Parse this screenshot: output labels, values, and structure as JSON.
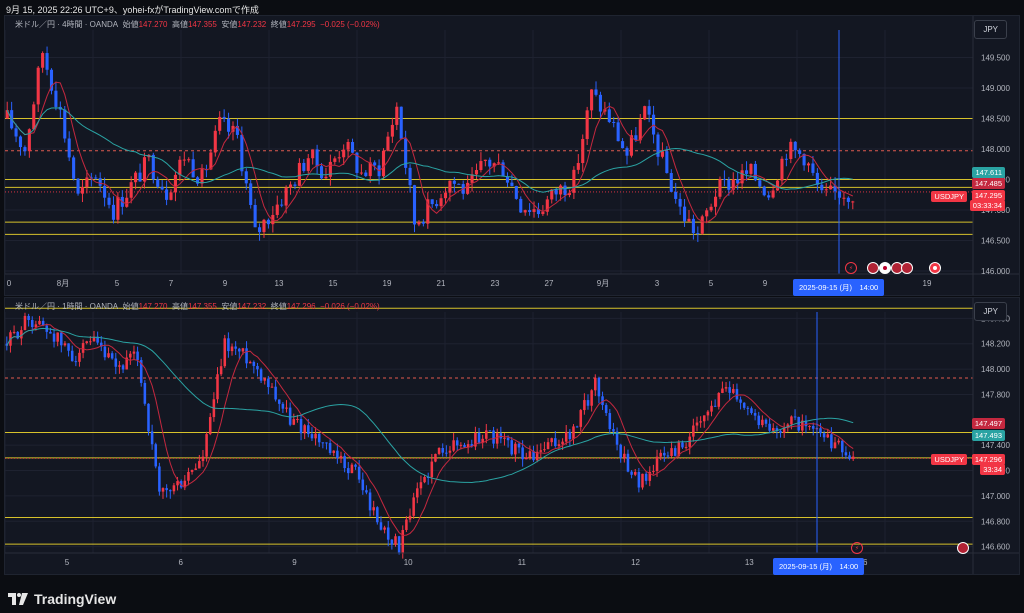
{
  "header": {
    "text": "9月 15, 2025 22:26 UTC+9、yohei-fxがTradingView.comで作成"
  },
  "brand": {
    "name": "TradingView",
    "icon": "tradingview-logo-icon"
  },
  "colors": {
    "bull": "#f23645",
    "bear": "#2962ff",
    "bg": "#131722",
    "grid": "#1e2230",
    "yellow": "#d6c22b",
    "red_dash": "#e05a4f",
    "ma_fast": "#c4283f",
    "ma_slow": "#2aa3a3",
    "green": "#4caf50"
  },
  "panes": [
    {
      "id": "top",
      "legend": {
        "symbol": "米ドル／円 · 4時間 · OANDA",
        "o_label": "始値",
        "o": "147.270",
        "h_label": "高値",
        "h": "147.355",
        "l_label": "安値",
        "l": "147.232",
        "c_label": "終値",
        "c": "147.295",
        "chg": "−0.025 (−0.02%)"
      },
      "currency": "JPY",
      "y_labels": [
        "149.500",
        "149.000",
        "148.500",
        "148.000",
        "147.500",
        "147.000",
        "146.500",
        "146.000"
      ],
      "x_labels": [
        "0",
        "8月",
        "5",
        "7",
        "9",
        "13",
        "15",
        "19",
        "21",
        "23",
        "27",
        "9月",
        "3",
        "5",
        "9",
        "11",
        "15",
        "19"
      ],
      "price_tags": [
        {
          "text": "147.611",
          "bg": "#2aa3a3"
        },
        {
          "text": "147.485",
          "bg": "#c4283f"
        },
        {
          "text": "147.295",
          "bg": "#f23645"
        },
        {
          "text": "03:33:34",
          "bg": "#f23645"
        }
      ],
      "symbol_tag": "USDJPY",
      "time_tag": "2025-09-15 (月)　14:00"
    },
    {
      "id": "bottom",
      "legend": {
        "symbol": "米ドル／円 · 1時間 · OANDA",
        "o_label": "始値",
        "o": "147.270",
        "h_label": "高値",
        "h": "147.355",
        "l_label": "安値",
        "l": "147.232",
        "c_label": "終値",
        "c": "147.296",
        "chg": "−0.026 (−0.02%)"
      },
      "currency": "JPY",
      "y_labels": [
        "148.400",
        "148.200",
        "148.000",
        "147.800",
        "147.400",
        "147.200",
        "147.000",
        "146.800",
        "146.600"
      ],
      "x_labels": [
        "5",
        "6",
        "9",
        "10",
        "11",
        "12",
        "13",
        "16"
      ],
      "price_tags": [
        {
          "text": "147.497",
          "bg": "#c4283f"
        },
        {
          "text": "147.493",
          "bg": "#2aa3a3"
        },
        {
          "text": "147.296",
          "bg": "#f23645"
        },
        {
          "text": "33:34",
          "bg": "#f23645"
        }
      ],
      "symbol_tag": "USDJPY",
      "time_tag": "2025-09-15 (月)　14:00"
    }
  ],
  "chart_data": [
    {
      "type": "candlestick",
      "title": "米ドル／円 · 4時間 · OANDA",
      "ylim": [
        145.95,
        149.95
      ],
      "horizontal_levels": [
        148.5,
        147.97,
        147.5,
        147.37,
        146.8,
        146.6
      ],
      "current_price": 147.295,
      "close_path": [
        148.5,
        148.0,
        149.6,
        148.6,
        147.2,
        147.6,
        147.0,
        147.4,
        147.8,
        147.3,
        147.9,
        147.5,
        148.4,
        148.2,
        146.6,
        147.0,
        147.4,
        147.9,
        147.6,
        148.1,
        147.6,
        147.7,
        148.7,
        146.8,
        147.1,
        147.5,
        147.3,
        147.8,
        147.7,
        147.1,
        147.0,
        147.3,
        147.5,
        148.9,
        148.5,
        147.9,
        148.6,
        147.8,
        147.0,
        146.6,
        147.3,
        147.5,
        147.6,
        147.3,
        148.0,
        147.9,
        147.2,
        147.3,
        147.28
      ]
    },
    {
      "type": "candlestick",
      "title": "米ドル／円 · 1時間 · OANDA",
      "ylim": [
        146.55,
        148.45
      ],
      "horizontal_levels": [
        148.48,
        147.93,
        147.5,
        147.3,
        146.83,
        146.62
      ],
      "current_price": 147.296,
      "close_path": [
        148.2,
        148.4,
        148.3,
        148.1,
        148.2,
        148.0,
        148.1,
        147.0,
        147.1,
        147.3,
        148.2,
        148.1,
        147.9,
        147.6,
        147.5,
        147.3,
        147.2,
        146.8,
        146.6,
        147.1,
        147.4,
        147.4,
        147.5,
        147.4,
        147.3,
        147.4,
        147.5,
        147.9,
        147.4,
        147.1,
        147.3,
        147.4,
        147.6,
        147.9,
        147.7,
        147.5,
        147.6,
        147.5,
        147.4,
        147.3
      ]
    }
  ]
}
